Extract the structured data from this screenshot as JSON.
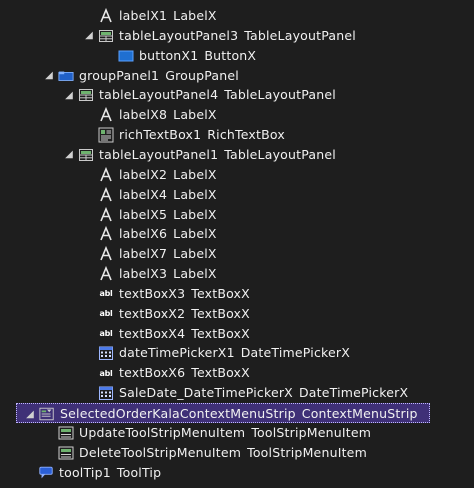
{
  "tree": {
    "nodes": [
      {
        "name": "labelX1",
        "type": "LabelX",
        "icon": "labelx-icon",
        "expander": "",
        "depth": 4
      },
      {
        "name": "tableLayoutPanel3",
        "type": "TableLayoutPanel",
        "icon": "table-layout-panel-icon",
        "expander": "collapse",
        "depth": 4
      },
      {
        "name": "buttonX1",
        "type": "ButtonX",
        "icon": "button-icon",
        "expander": "",
        "depth": 5
      },
      {
        "name": "groupPanel1",
        "type": "GroupPanel",
        "icon": "group-panel-icon",
        "expander": "collapse",
        "depth": 2
      },
      {
        "name": "tableLayoutPanel4",
        "type": "TableLayoutPanel",
        "icon": "table-layout-panel-icon",
        "expander": "collapse",
        "depth": 3
      },
      {
        "name": "labelX8",
        "type": "LabelX",
        "icon": "labelx-icon",
        "expander": "",
        "depth": 4
      },
      {
        "name": "richTextBox1",
        "type": "RichTextBox",
        "icon": "rich-text-box-icon",
        "expander": "",
        "depth": 4
      },
      {
        "name": "tableLayoutPanel1",
        "type": "TableLayoutPanel",
        "icon": "table-layout-panel-icon",
        "expander": "collapse",
        "depth": 3
      },
      {
        "name": "labelX2",
        "type": "LabelX",
        "icon": "labelx-icon",
        "expander": "",
        "depth": 4
      },
      {
        "name": "labelX4",
        "type": "LabelX",
        "icon": "labelx-icon",
        "expander": "",
        "depth": 4
      },
      {
        "name": "labelX5",
        "type": "LabelX",
        "icon": "labelx-icon",
        "expander": "",
        "depth": 4
      },
      {
        "name": "labelX6",
        "type": "LabelX",
        "icon": "labelx-icon",
        "expander": "",
        "depth": 4
      },
      {
        "name": "labelX7",
        "type": "LabelX",
        "icon": "labelx-icon",
        "expander": "",
        "depth": 4
      },
      {
        "name": "labelX3",
        "type": "LabelX",
        "icon": "labelx-icon",
        "expander": "",
        "depth": 4
      },
      {
        "name": "textBoxX3",
        "type": "TextBoxX",
        "icon": "textbox-icon",
        "expander": "",
        "depth": 4
      },
      {
        "name": "textBoxX2",
        "type": "TextBoxX",
        "icon": "textbox-icon",
        "expander": "",
        "depth": 4
      },
      {
        "name": "textBoxX4",
        "type": "TextBoxX",
        "icon": "textbox-icon",
        "expander": "",
        "depth": 4
      },
      {
        "name": "dateTimePickerX1",
        "type": "DateTimePickerX",
        "icon": "date-time-picker-icon",
        "expander": "",
        "depth": 4
      },
      {
        "name": "textBoxX6",
        "type": "TextBoxX",
        "icon": "textbox-icon",
        "expander": "",
        "depth": 4
      },
      {
        "name": "SaleDate_DateTimePickerX",
        "type": "DateTimePickerX",
        "icon": "date-time-picker-icon",
        "expander": "",
        "depth": 4
      },
      {
        "name": "SelectedOrderKalaContextMenuStrip",
        "type": "ContextMenuStrip",
        "icon": "context-menu-strip-icon",
        "expander": "collapse",
        "depth": 1,
        "selected": true
      },
      {
        "name": "UpdateToolStripMenuItem",
        "type": "ToolStripMenuItem",
        "icon": "tool-strip-menu-item-icon",
        "expander": "",
        "depth": 2
      },
      {
        "name": "DeleteToolStripMenuItem",
        "type": "ToolStripMenuItem",
        "icon": "tool-strip-menu-item-icon",
        "expander": "",
        "depth": 2
      },
      {
        "name": "toolTip1",
        "type": "ToolTip",
        "icon": "tooltip-icon",
        "expander": "",
        "depth": 1
      }
    ],
    "textbox_icon_text": "abl",
    "colors": {
      "background": "#1e1e1e",
      "selection": "#3f3077",
      "text": "#f1f1f1"
    }
  }
}
